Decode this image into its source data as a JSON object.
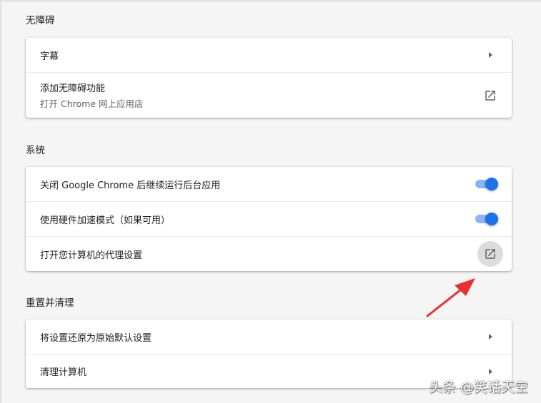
{
  "accessibility": {
    "title": "无障碍",
    "captions_label": "字幕",
    "add_features_label": "添加无障碍功能",
    "add_features_sub": "打开 Chrome 网上应用店"
  },
  "system": {
    "title": "系统",
    "background_apps_label": "关闭 Google Chrome 后继续运行后台应用",
    "background_apps_on": true,
    "hw_accel_label": "使用硬件加速模式（如果可用）",
    "hw_accel_on": true,
    "proxy_label": "打开您计算机的代理设置"
  },
  "reset": {
    "title": "重置并清理",
    "restore_label": "将设置还原为原始默认设置",
    "cleanup_label": "清理计算机"
  },
  "colors": {
    "accent": "#1a73e8",
    "annotation_arrow": "#e8302e"
  },
  "watermark": "头条 @笑话天空"
}
